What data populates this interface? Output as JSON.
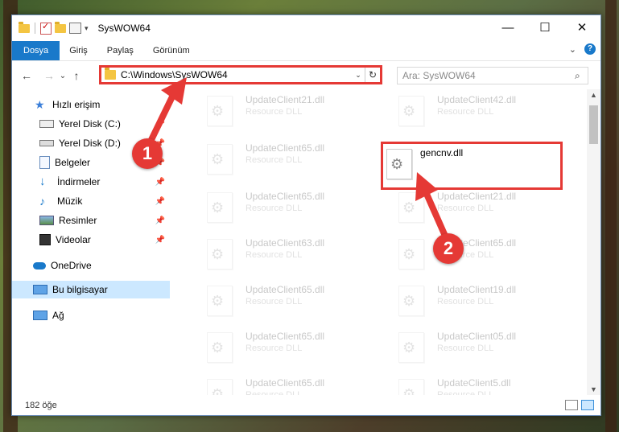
{
  "window": {
    "title": "SysWOW64",
    "controls": {
      "minimize": "—",
      "maximize": "☐",
      "close": "✕"
    }
  },
  "ribbon": {
    "tabs": [
      {
        "label": "Dosya",
        "active": true
      },
      {
        "label": "Giriş"
      },
      {
        "label": "Paylaş"
      },
      {
        "label": "Görünüm"
      }
    ],
    "expand": "⌄",
    "help": "?"
  },
  "nav": {
    "back": "←",
    "forward": "→",
    "recent": "⌄",
    "up": "↑",
    "address": "C:\\Windows\\SysWOW64",
    "address_dropdown": "⌄",
    "refresh": "↻",
    "search_placeholder": "Ara: SysWOW64",
    "search_icon": "⌕"
  },
  "sidebar": {
    "items": [
      {
        "label": "Hızlı erişim",
        "icon": "star-icon"
      },
      {
        "label": "Yerel Disk (C:)",
        "icon": "drive-icon",
        "pinned": true
      },
      {
        "label": "Yerel Disk (D:)",
        "icon": "drive-icon",
        "pinned": true
      },
      {
        "label": "Belgeler",
        "icon": "documents-icon",
        "pinned": true
      },
      {
        "label": "İndirmeler",
        "icon": "download-icon",
        "pinned": true
      },
      {
        "label": "Müzik",
        "icon": "music-icon",
        "pinned": true
      },
      {
        "label": "Resimler",
        "icon": "pictures-icon",
        "pinned": true
      },
      {
        "label": "Videolar",
        "icon": "video-icon",
        "pinned": true
      },
      {
        "label": "OneDrive",
        "icon": "cloud-icon"
      },
      {
        "label": "Bu bilgisayar",
        "icon": "computer-icon",
        "selected": true
      },
      {
        "label": "Ağ",
        "icon": "network-icon"
      }
    ],
    "pin_glyph": "📌"
  },
  "files": [
    {
      "name": "UpdateClient21.dll",
      "type": "Resource DLL"
    },
    {
      "name": "UpdateClient42.dll",
      "type": "Resource DLL"
    },
    {
      "name": "UpdateClient65.dll",
      "type": "Resource DLL"
    },
    {
      "name": "gencnv.dll",
      "type": ""
    },
    {
      "name": "UpdateClient65.dll",
      "type": "Resource DLL"
    },
    {
      "name": "UpdateClient21.dll",
      "type": "Resource DLL"
    },
    {
      "name": "UpdateClient63.dll",
      "type": "Resource DLL"
    },
    {
      "name": "UpdateClient65.dll",
      "type": "Resource DLL"
    },
    {
      "name": "UpdateClient65.dll",
      "type": "Resource DLL"
    },
    {
      "name": "UpdateClient19.dll",
      "type": "Resource DLL"
    },
    {
      "name": "UpdateClient65.dll",
      "type": "Resource DLL"
    },
    {
      "name": "UpdateClient05.dll",
      "type": "Resource DLL"
    },
    {
      "name": "UpdateClient65.dll",
      "type": "Resource DLL"
    },
    {
      "name": "UpdateClient5.dll",
      "type": "Resource DLL"
    }
  ],
  "status": {
    "item_count": "182 öğe"
  },
  "callouts": {
    "one": "1",
    "two": "2"
  },
  "colors": {
    "accent": "#1979ca",
    "highlight": "#e53935",
    "selected": "#cce8ff"
  }
}
